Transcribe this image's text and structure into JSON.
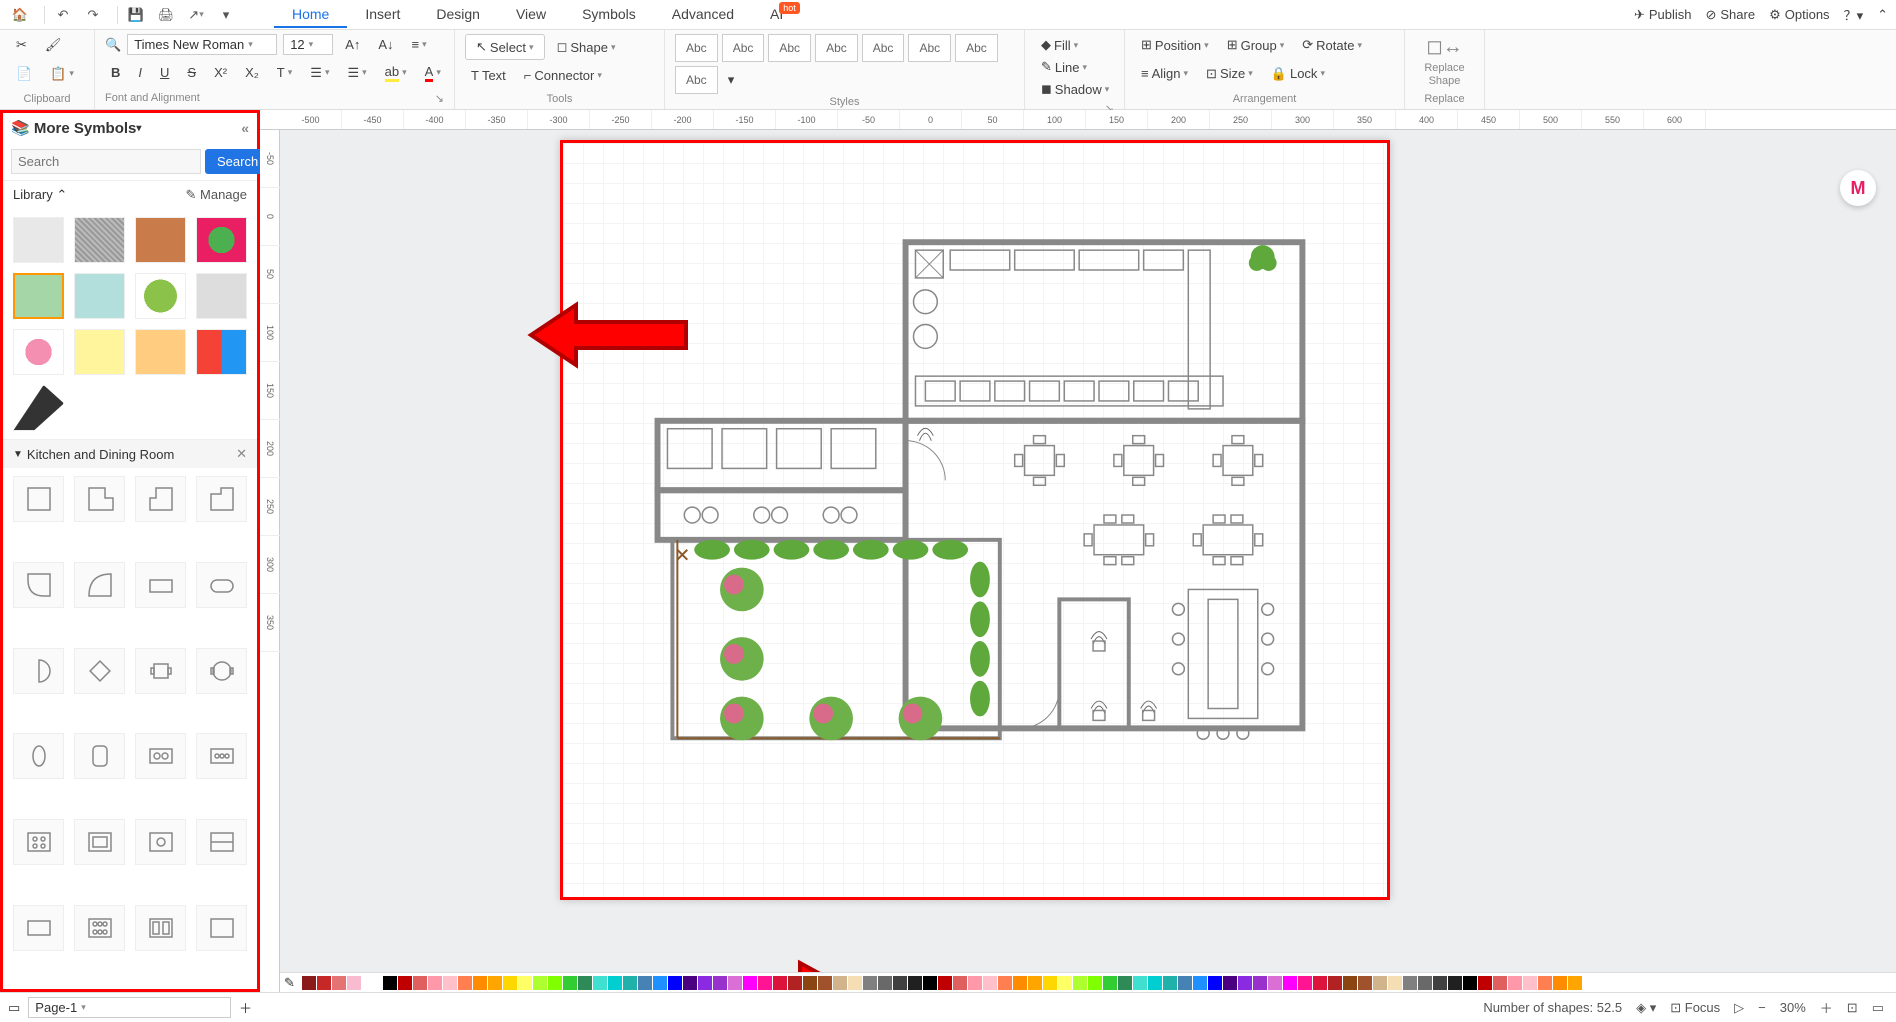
{
  "titlebar": {
    "tabs": [
      "Home",
      "Insert",
      "Design",
      "View",
      "Symbols",
      "Advanced",
      "AI"
    ],
    "active_tab": 0,
    "hot_badge": "hot",
    "right": {
      "publish": "Publish",
      "share": "Share",
      "options": "Options"
    }
  },
  "ribbon": {
    "clipboard": {
      "label": "Clipboard"
    },
    "font": {
      "name": "Times New Roman",
      "size": "12",
      "label": "Font and Alignment"
    },
    "tools": {
      "select": "Select",
      "text": "Text",
      "shape": "Shape",
      "connector": "Connector",
      "label": "Tools"
    },
    "styles": {
      "items": [
        "Abc",
        "Abc",
        "Abc",
        "Abc",
        "Abc",
        "Abc",
        "Abc",
        "Abc"
      ],
      "label": "Styles"
    },
    "fill": {
      "fill": "Fill",
      "line": "Line",
      "shadow": "Shadow"
    },
    "arrangement": {
      "position": "Position",
      "align": "Align",
      "group": "Group",
      "size": "Size",
      "rotate": "Rotate",
      "lock": "Lock",
      "label": "Arrangement"
    },
    "replace": {
      "label": "Replace",
      "btn": "Replace Shape"
    }
  },
  "sidebar": {
    "title": "More Symbols",
    "search_placeholder": "Search",
    "search_btn": "Search",
    "library": "Library",
    "manage": "Manage",
    "category": "Kitchen and Dining Room"
  },
  "ruler_h": [
    "-500",
    "-450",
    "-400",
    "-350",
    "-300",
    "-250",
    "-200",
    "-150",
    "-100",
    "-50",
    "0",
    "50",
    "100",
    "150",
    "200",
    "250",
    "300",
    "350",
    "400",
    "450",
    "500",
    "550",
    "600"
  ],
  "ruler_v": [
    "-50",
    "0",
    "50",
    "100",
    "150",
    "200",
    "250",
    "300",
    "350"
  ],
  "colors": [
    "#000000",
    "#c00000",
    "#e06060",
    "#ff99aa",
    "#ffc0cb",
    "#ff7f50",
    "#ff8c00",
    "#ffa500",
    "#ffd700",
    "#ffff66",
    "#adff2f",
    "#7fff00",
    "#32cd32",
    "#2e8b57",
    "#40e0d0",
    "#00ced1",
    "#20b2aa",
    "#4682b4",
    "#1e90ff",
    "#0000ff",
    "#4b0082",
    "#8a2be2",
    "#9932cc",
    "#da70d6",
    "#ff00ff",
    "#ff1493",
    "#dc143c",
    "#b22222",
    "#8b4513",
    "#a0522d",
    "#d2b48c",
    "#f5deb3",
    "#808080",
    "#696969",
    "#404040",
    "#202020"
  ],
  "statusbar": {
    "page": "Page-1",
    "shapes_label": "Number of shapes:",
    "shapes": "52.5",
    "focus": "Focus",
    "zoom": "30%"
  },
  "pagebar": {
    "page": "Page-1"
  }
}
